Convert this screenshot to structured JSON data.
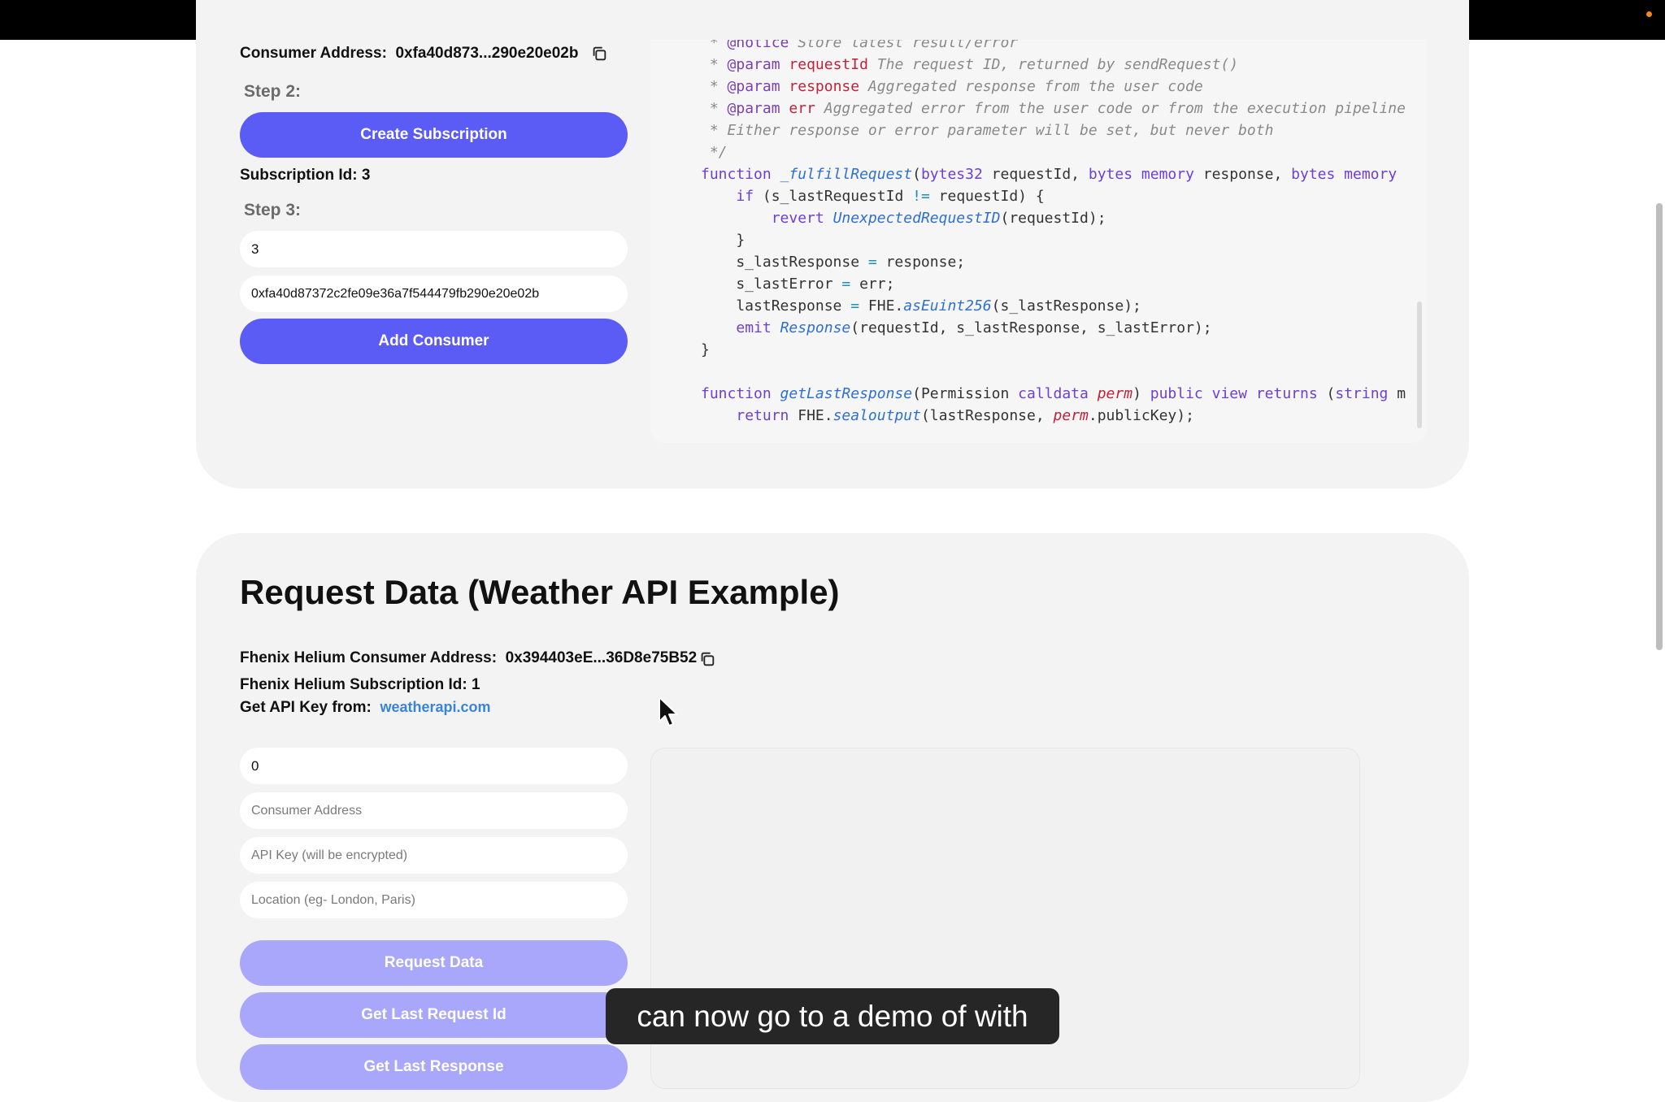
{
  "colors": {
    "accent": "#5b5bf5",
    "accent_disabled": "#a9a7fb",
    "link": "#3a84d6",
    "recording_dot": "#f08a1c"
  },
  "setup": {
    "consumer_label": "Consumer Address:",
    "consumer_value": "0xfa40d873...290e20e02b",
    "step2_label": "Step 2:",
    "create_subscription_label": "Create Subscription",
    "subscription_id_text": "Subscription Id: 3",
    "step3_label": "Step 3:",
    "subscription_input_value": "3",
    "consumer_input_value": "0xfa40d87372c2fe09e36a7f544479fb290e20e02b",
    "add_consumer_label": "Add Consumer"
  },
  "code": {
    "lines": [
      " * @notice Store latest result/error",
      " * @param requestId The request ID, returned by sendRequest()",
      " * @param response Aggregated response from the user code",
      " * @param err Aggregated error from the user code or from the execution pipeline",
      " * Either response or error parameter will be set, but never both",
      " */",
      "function _fulfillRequest(bytes32 requestId, bytes memory response, bytes memory",
      "    if (s_lastRequestId != requestId) {",
      "        revert UnexpectedRequestID(requestId);",
      "    }",
      "    s_lastResponse = response;",
      "    s_lastError = err;",
      "    lastResponse = FHE.asEuint256(s_lastResponse);",
      "    emit Response(requestId, s_lastResponse, s_lastError);",
      "}",
      "",
      "function getLastResponse(Permission calldata perm) public view returns (string m",
      "    return FHE.sealoutput(lastResponse, perm.publicKey);"
    ]
  },
  "request": {
    "title": "Request Data (Weather API Example)",
    "consumer_label": "Fhenix Helium Consumer Address:",
    "consumer_value": "0x394403eE...36D8e75B52",
    "subscription_text": "Fhenix Helium Subscription Id: 1",
    "api_key_label": "Get API Key from:",
    "api_key_link": "weatherapi.com",
    "subscription_input_value": "0",
    "consumer_placeholder": "Consumer Address",
    "api_key_placeholder": "API Key (will be encrypted)",
    "location_placeholder": "Location (eg- London, Paris)",
    "request_data_label": "Request Data",
    "get_last_request_label": "Get Last Request Id",
    "get_last_response_label": "Get Last Response"
  },
  "caption": "can now go to a demo of with"
}
